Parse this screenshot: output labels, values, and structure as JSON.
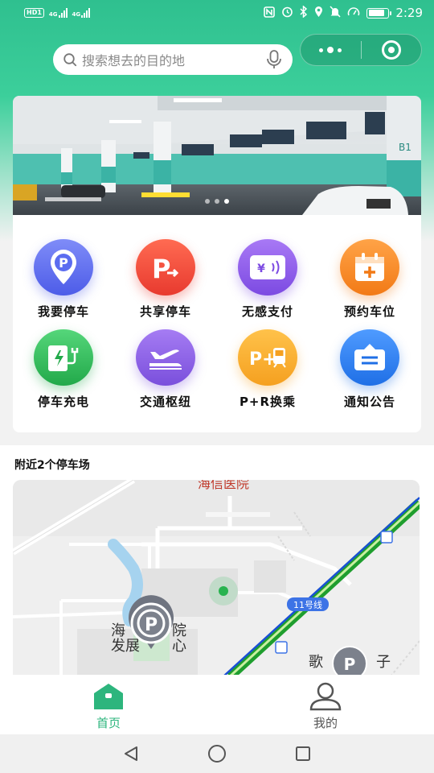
{
  "status_bar": {
    "hd": "HD",
    "sim1": "1",
    "net1": "4G",
    "net2": "4G",
    "time": "2:29",
    "battery_level": 0.85
  },
  "search": {
    "placeholder": "搜索想去的目的地"
  },
  "banner": {
    "sign_text": "B1",
    "slide_count": 3,
    "active_slide": 2
  },
  "grid": {
    "items": [
      {
        "label": "我要停车",
        "icon": "parking-pin-icon",
        "color": "#5b6cf0"
      },
      {
        "label": "共享停车",
        "icon": "share-parking-icon",
        "color": "#f0453a"
      },
      {
        "label": "无感支付",
        "icon": "payment-card-icon",
        "color": "#8a55e8"
      },
      {
        "label": "预约车位",
        "icon": "calendar-plus-icon",
        "color": "#f28a22"
      },
      {
        "label": "停车充电",
        "icon": "charging-icon",
        "color": "#2fbf5a"
      },
      {
        "label": "交通枢纽",
        "icon": "plane-train-icon",
        "color": "#8a55e8"
      },
      {
        "label": "P+R换乘",
        "icon": "park-ride-icon",
        "color": "#f5a623"
      },
      {
        "label": "通知公告",
        "icon": "notice-icon",
        "color": "#2f7cf0"
      }
    ]
  },
  "nearby": {
    "title": "附近2个停车场"
  },
  "map": {
    "label_top": "海信医院",
    "label_center_1": "海",
    "label_center_2": "院",
    "label_center_3": "发展",
    "label_center_4": "心",
    "metro_line": "11号线",
    "label_right": "歌",
    "label_right_2": "子",
    "parking_marker": "P"
  },
  "tabbar": {
    "home_label": "首页",
    "mine_label": "我的",
    "active_color": "#2db57d"
  }
}
